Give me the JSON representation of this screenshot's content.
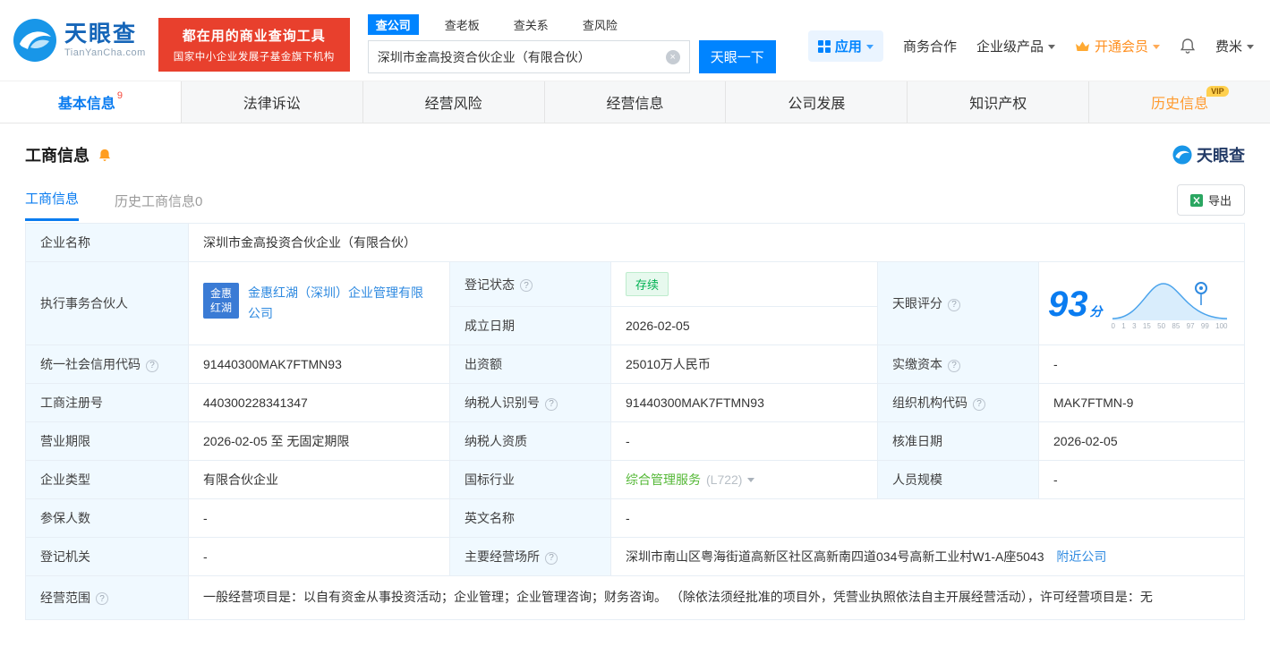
{
  "icons": {
    "help": "?",
    "clear": "×"
  },
  "header": {
    "logo": {
      "title": "天眼查",
      "subtitle": "TianYanCha.com"
    },
    "banner": {
      "line1": "都在用的商业查询工具",
      "line2": "国家中小企业发展子基金旗下机构"
    },
    "search": {
      "tabs": [
        {
          "label": "查公司"
        },
        {
          "label": "查老板"
        },
        {
          "label": "查关系"
        },
        {
          "label": "查风险"
        }
      ],
      "value": "深圳市金高投资合伙企业（有限合伙）",
      "button": "天眼一下"
    },
    "nav": {
      "apps": "应用",
      "cooperation": "商务合作",
      "enterprise": "企业级产品",
      "vip": "开通会员",
      "user": "费米"
    }
  },
  "tabs": [
    {
      "label": "基本信息",
      "badge": "9"
    },
    {
      "label": "法律诉讼"
    },
    {
      "label": "经营风险"
    },
    {
      "label": "经营信息"
    },
    {
      "label": "公司发展"
    },
    {
      "label": "知识产权"
    },
    {
      "label": "历史信息",
      "vip_tag": "VIP"
    }
  ],
  "section": {
    "title": "工商信息",
    "brand": "天眼查",
    "subtabs": [
      {
        "label": "工商信息"
      },
      {
        "label": "历史工商信息0"
      }
    ],
    "export": "导出"
  },
  "info": {
    "company_name": {
      "label": "企业名称",
      "value": "深圳市金高投资合伙企业（有限合伙）"
    },
    "partner": {
      "label": "执行事务合伙人",
      "logo_line1": "金惠",
      "logo_line2": "红湖",
      "link": "金惠红湖（深圳）企业管理有限公司"
    },
    "reg_status": {
      "label": "登记状态",
      "value": "存续"
    },
    "establish_date": {
      "label": "成立日期",
      "value": "2026-02-05"
    },
    "score": {
      "label": "天眼评分",
      "value": "93",
      "unit": "分",
      "axis": [
        "0",
        "1",
        "3",
        "15",
        "50",
        "85",
        "97",
        "99",
        "100"
      ]
    },
    "credit_code": {
      "label": "统一社会信用代码",
      "value": "91440300MAK7FTMN93"
    },
    "capital": {
      "label": "出资额",
      "value": "25010万人民币"
    },
    "paid_capital": {
      "label": "实缴资本",
      "value": "-"
    },
    "reg_number": {
      "label": "工商注册号",
      "value": "440300228341347"
    },
    "taxpayer_id": {
      "label": "纳税人识别号",
      "value": "91440300MAK7FTMN93"
    },
    "org_code": {
      "label": "组织机构代码",
      "value": "MAK7FTMN-9"
    },
    "business_term": {
      "label": "营业期限",
      "value": "2026-02-05 至 无固定期限"
    },
    "taxpayer_quality": {
      "label": "纳税人资质",
      "value": "-"
    },
    "approval_date": {
      "label": "核准日期",
      "value": "2026-02-05"
    },
    "company_type": {
      "label": "企业类型",
      "value": "有限合伙企业"
    },
    "industry": {
      "label": "国标行业",
      "value": "综合管理服务",
      "code": "(L722)"
    },
    "staff_size": {
      "label": "人员规模",
      "value": "-"
    },
    "insured_count": {
      "label": "参保人数",
      "value": "-"
    },
    "english_name": {
      "label": "英文名称",
      "value": "-"
    },
    "reg_authority": {
      "label": "登记机关",
      "value": "-"
    },
    "business_place": {
      "label": "主要经营场所",
      "value": "深圳市南山区粤海街道高新区社区高新南四道034号高新工业村W1-A座5043",
      "nearby": "附近公司"
    },
    "business_scope": {
      "label": "经营范围",
      "value": "一般经营项目是：以自有资金从事投资活动；企业管理；企业管理咨询；财务咨询。 （除依法须经批准的项目外，凭营业执照依法自主开展经营活动），许可经营项目是：无"
    }
  }
}
